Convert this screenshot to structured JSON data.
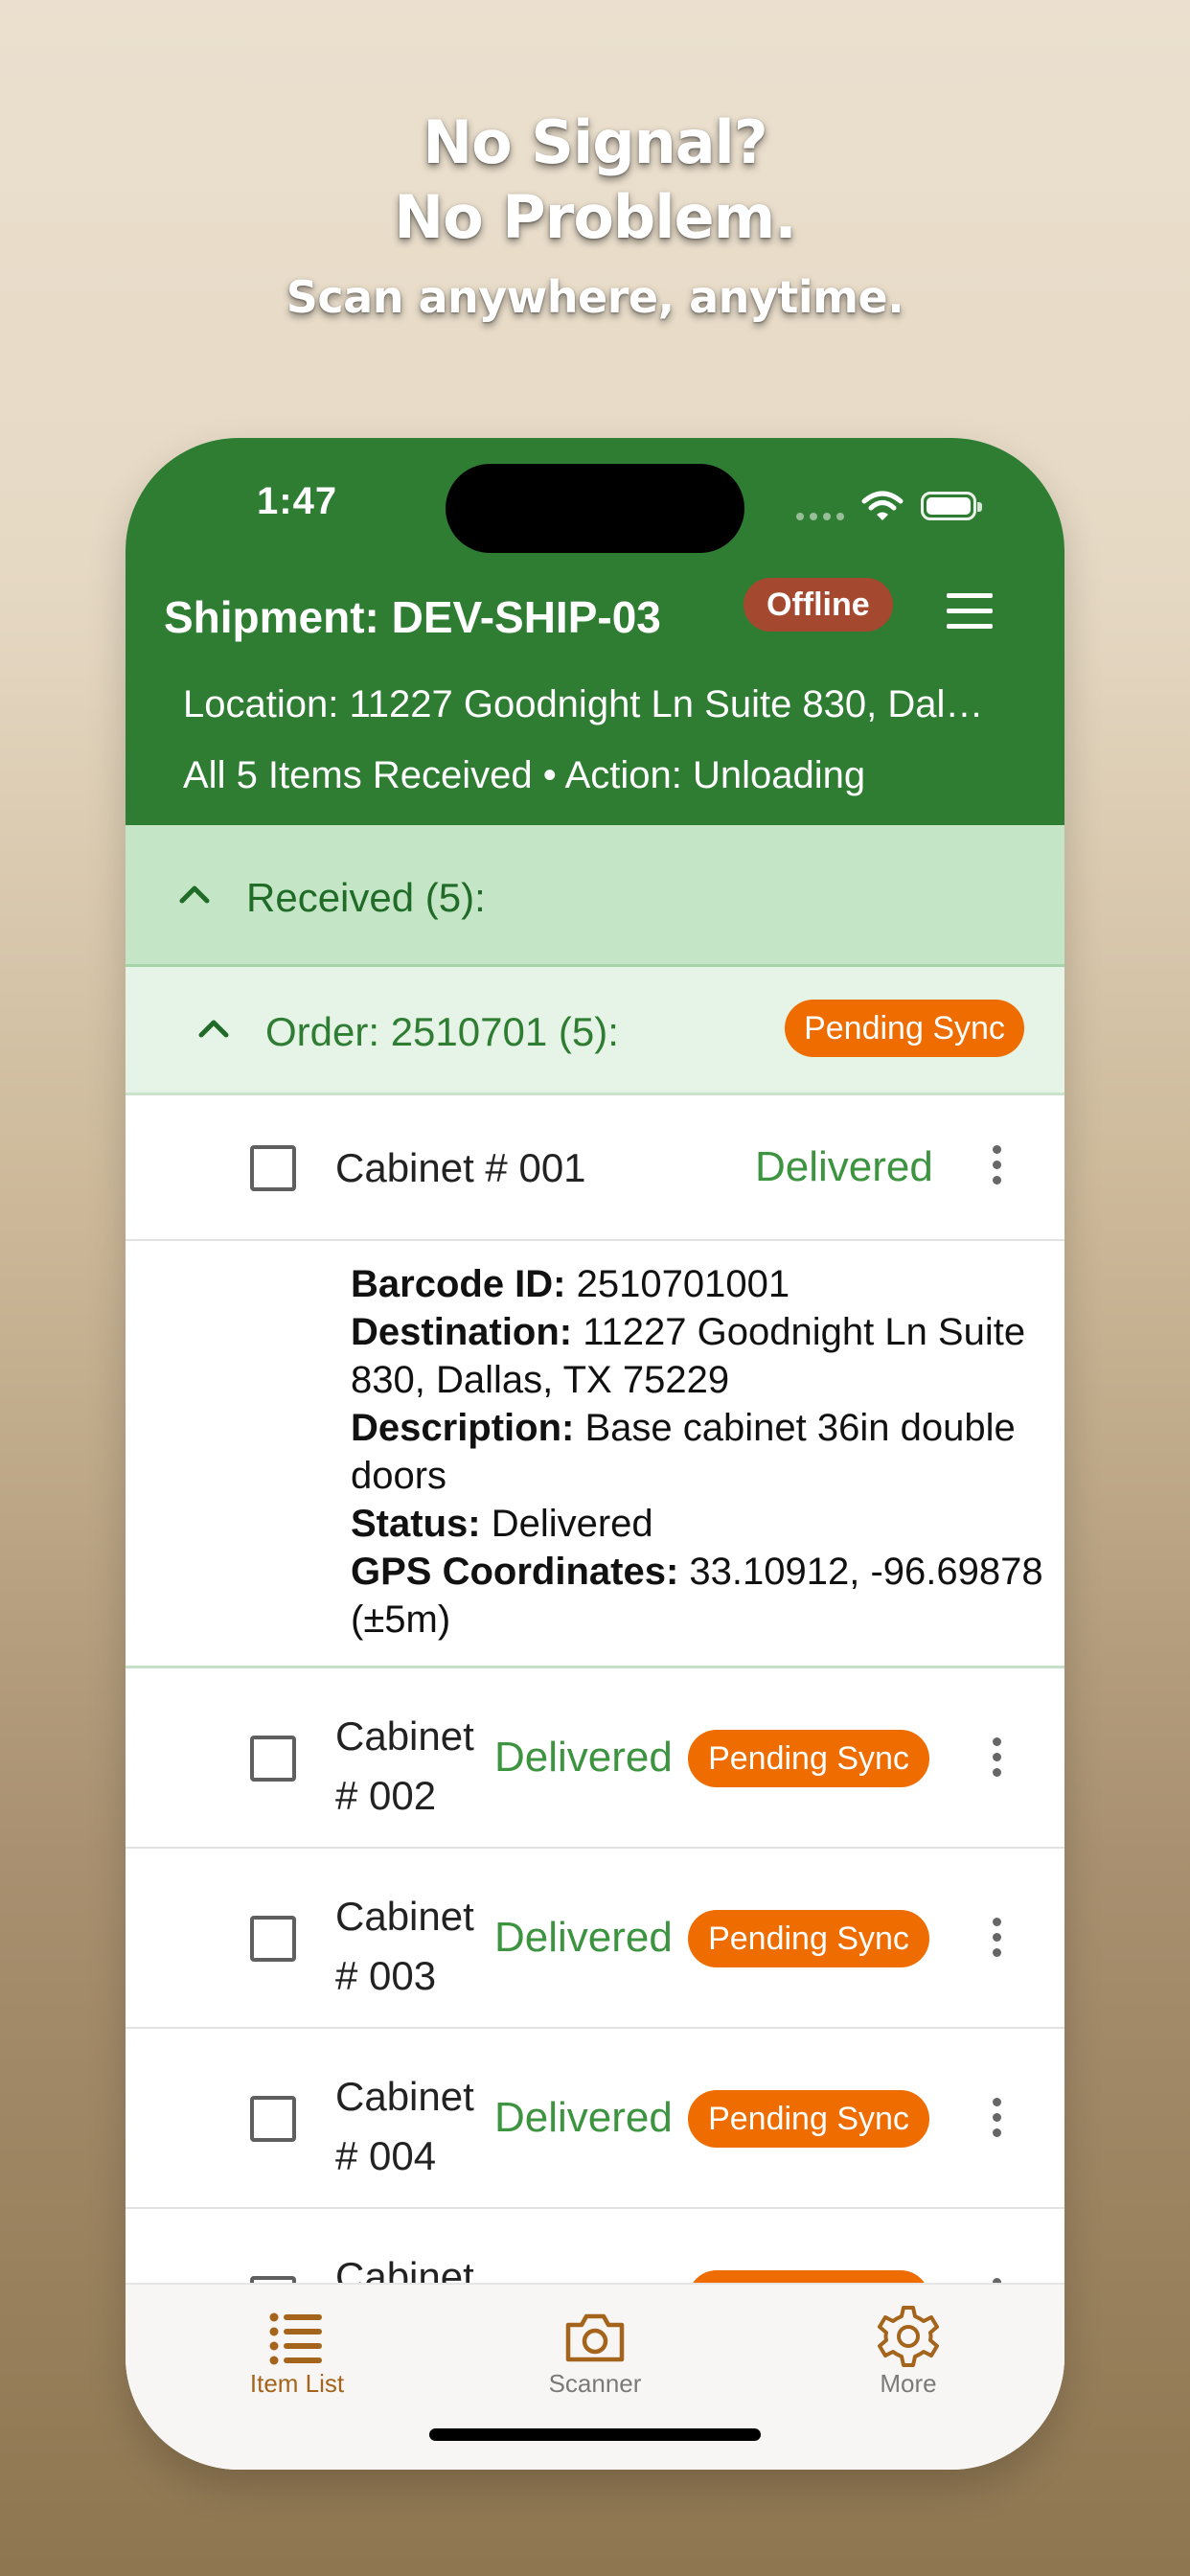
{
  "headline": {
    "line1": "No Signal?",
    "line2": "No Problem.",
    "subtitle": "Scan anywhere, anytime."
  },
  "status_bar": {
    "time": "1:47"
  },
  "header": {
    "title": "Shipment: DEV-SHIP-03",
    "offline_badge": "Offline",
    "location": "Location: 11227 Goodnight Ln Suite 830, Dallas, TX 75229",
    "summary": "All 5 Items Received • Action: Unloading"
  },
  "received_section": {
    "label": "Received (5):"
  },
  "order_section": {
    "label": "Order: 2510701 (5):",
    "badge": "Pending Sync"
  },
  "items": [
    {
      "name": "Cabinet # 001",
      "status": "Delivered"
    },
    {
      "name": "Cabinet # 002",
      "status": "Delivered",
      "badge": "Pending Sync"
    },
    {
      "name": "Cabinet # 003",
      "status": "Delivered",
      "badge": "Pending Sync"
    },
    {
      "name": "Cabinet # 004",
      "status": "Delivered",
      "badge": "Pending Sync"
    },
    {
      "name": "Cabinet",
      "status": "",
      "badge": ""
    }
  ],
  "item_detail": {
    "barcode_label": "Barcode ID:",
    "barcode_value": "2510701001",
    "destination_label": "Destination:",
    "destination_value": "11227 Goodnight Ln Suite 830, Dallas, TX 75229",
    "description_label": "Description:",
    "description_value": "Base cabinet 36in double doors",
    "status_label": "Status:",
    "status_value": "Delivered",
    "gps_label": "GPS Coordinates:",
    "gps_value": "33.10912, -96.69878 (±5m)"
  },
  "tabs": [
    {
      "label": "Item List",
      "icon": "list-icon",
      "active": true
    },
    {
      "label": "Scanner",
      "icon": "camera-icon",
      "active": false
    },
    {
      "label": "More",
      "icon": "gear-icon",
      "active": false
    }
  ],
  "colors": {
    "header_green": "#2e7d32",
    "received_bg": "#c5e5c7",
    "order_bg": "#e6f4e7",
    "delivered_green": "#3d9440",
    "pending_orange": "#ef6c00",
    "offline_red": "#a4482f",
    "tab_active": "#a5641c",
    "tab_inactive": "#8a8a8a"
  }
}
